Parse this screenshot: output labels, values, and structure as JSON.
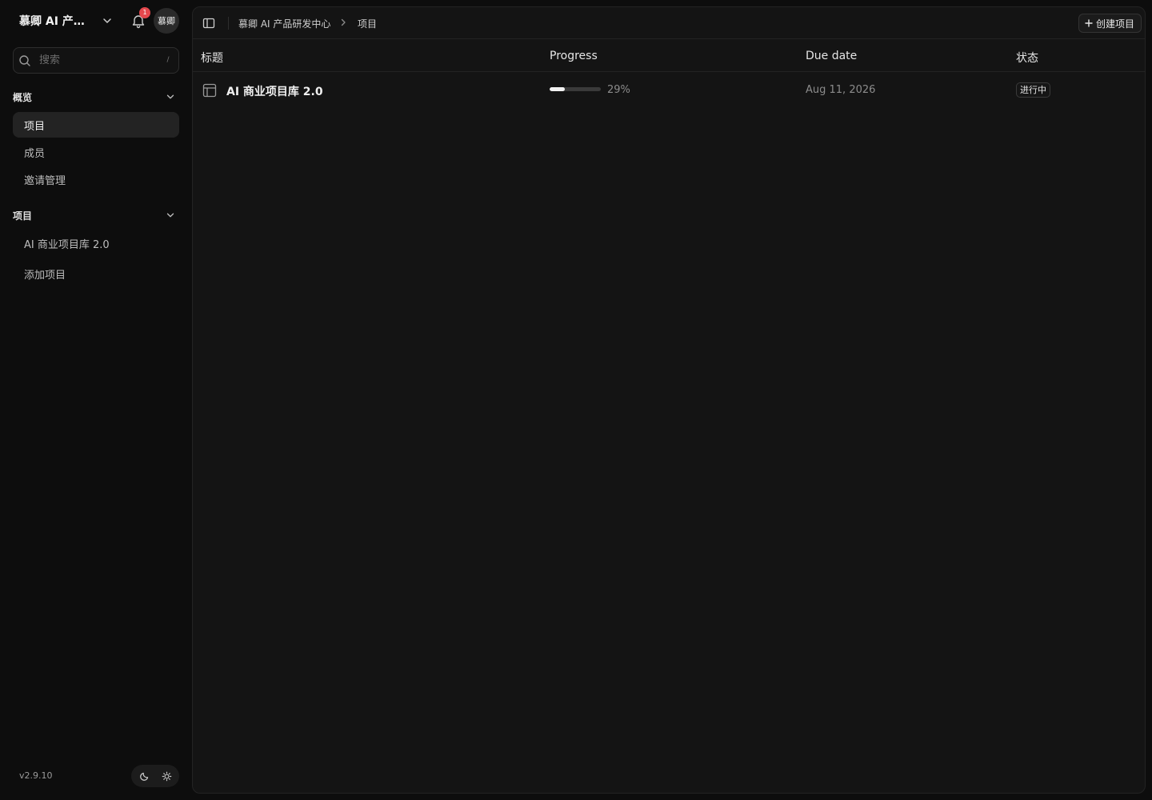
{
  "sidebar": {
    "workspace_name": "慕卿 AI 产品研发中心",
    "notification_count": "1",
    "avatar_text": "慕卿",
    "search_placeholder": "搜索",
    "search_shortcut": "/",
    "sections": [
      {
        "title": "概览",
        "items": [
          {
            "label": "项目",
            "active": true
          },
          {
            "label": "成员",
            "active": false
          },
          {
            "label": "邀请管理",
            "active": false
          }
        ]
      },
      {
        "title": "项目",
        "items": [
          {
            "label": "AI 商业项目库 2.0",
            "active": false
          },
          {
            "label": "添加项目",
            "active": false
          }
        ]
      }
    ],
    "version": "v2.9.10"
  },
  "topbar": {
    "breadcrumb": [
      "慕卿 AI 产品研发中心",
      "项目"
    ],
    "create_label": "创建项目"
  },
  "table": {
    "columns": [
      "标题",
      "Progress",
      "Due date",
      "状态"
    ],
    "rows": [
      {
        "title": "AI 商业项目库 2.0",
        "progress": 29,
        "progress_text": "29%",
        "due_date": "Aug 11, 2026",
        "status": "进行中"
      }
    ]
  },
  "colors": {
    "background": "#0d0d0d",
    "panel": "#141414",
    "active_item": "#232323",
    "badge_red": "#e5484d",
    "progress_fill": "#f2f2f2"
  },
  "icons": [
    "chevron-down-icon",
    "bell-icon",
    "search-icon",
    "sidebar-toggle-icon",
    "chevron-right-icon",
    "plus-icon",
    "table-layout-icon",
    "moon-icon",
    "sun-icon"
  ]
}
